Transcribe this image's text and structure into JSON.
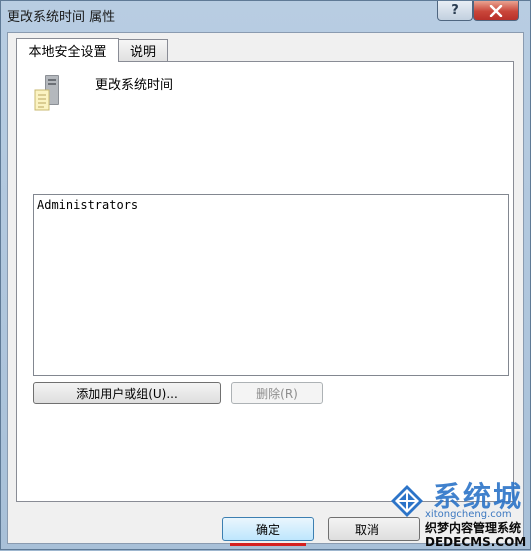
{
  "window": {
    "title": "更改系统时间 属性",
    "help_label": "?"
  },
  "tabs": [
    {
      "label": "本地安全设置",
      "active": true
    },
    {
      "label": "说明",
      "active": false
    }
  ],
  "policy": {
    "name": "更改系统时间",
    "icon": "policy-computer-icon"
  },
  "listbox": {
    "items": [
      "Administrators"
    ]
  },
  "buttons": {
    "add": "添加用户或组(U)...",
    "remove": "删除(R)",
    "ok": "确定",
    "cancel": "取消"
  },
  "watermark": {
    "brand": "系统城",
    "url_top": "xitongcheng.com",
    "cn_text": "织梦内容管理系统",
    "url": "DEDECMS.COM"
  },
  "colors": {
    "ok_underline": "#d42020",
    "close_button": "#c9463a"
  }
}
